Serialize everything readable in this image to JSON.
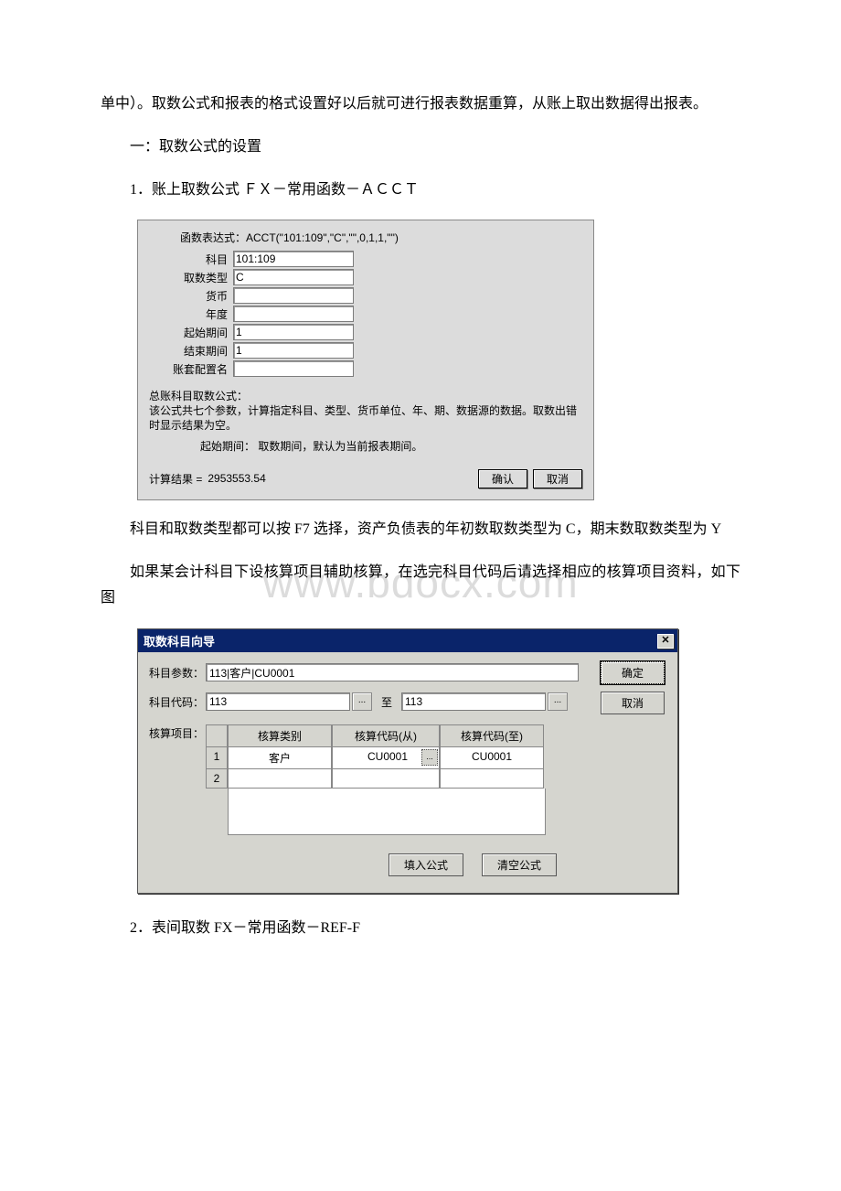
{
  "watermark": "www.bdocx.com",
  "text": {
    "p1": "单中）。取数公式和报表的格式设置好以后就可进行报表数据重算，从账上取出数据得出报表。",
    "p2": "一：取数公式的设置",
    "p3": "1．账上取数公式  ＦＸ－常用函数－ＡＣＣＴ",
    "p4": "科目和取数类型都可以按 F7 选择，资产负债表的年初数取数类型为 C，期末数取数类型为 Y",
    "p5": "如果某会计科目下设核算项目辅助核算，在选完科目代码后请选择相应的核算项目资料，如下图",
    "p6": "2．表间取数  FX－常用函数－REF-F"
  },
  "panel1": {
    "expr_label": "函数表达式：",
    "expr_value": "ACCT(\"101:109\",\"C\",\"\",0,1,1,\"\")",
    "fields": {
      "subject_label": "科目",
      "subject_value": "101:109",
      "type_label": "取数类型",
      "type_value": "C",
      "currency_label": "货币",
      "currency_value": "",
      "year_label": "年度",
      "year_value": "",
      "start_label": "起始期间",
      "start_value": "1",
      "end_label": "结束期间",
      "end_value": "1",
      "acct_label": "账套配置名",
      "acct_value": ""
    },
    "desc": {
      "title": "总账科目取数公式：",
      "body": "该公式共七个参数，计算指定科目、类型、货币单位、年、期、数据源的数据。取数出错时显示结果为空。",
      "sub_label": "起始期间：",
      "sub_body": "取数期间，默认为当前报表期间。"
    },
    "result_label": "计算结果 =",
    "result_value": "2953553.54",
    "ok": "确认",
    "cancel": "取消"
  },
  "dialog": {
    "title": "取数科目向导",
    "row1_label": "科目参数：",
    "row1_value": "113|客户|CU0001",
    "row2_label": "科目代码：",
    "row2_from": "113",
    "row2_to_label": "至",
    "row2_to": "113",
    "row3_label": "核算项目：",
    "headers": {
      "h1": "核算类别",
      "h2": "核算代码(从)",
      "h3": "核算代码(至)"
    },
    "rows": [
      {
        "n": "1",
        "cat": "客户",
        "from": "CU0001",
        "to": "CU0001"
      },
      {
        "n": "2",
        "cat": "",
        "from": "",
        "to": ""
      }
    ],
    "ok": "确定",
    "cancel": "取消",
    "fill": "填入公式",
    "clear": "清空公式",
    "ellipsis": "..."
  }
}
